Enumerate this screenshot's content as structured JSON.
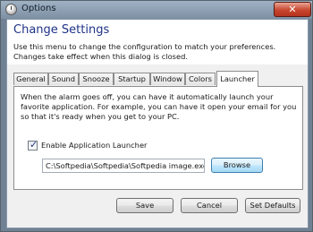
{
  "window": {
    "title": "Options",
    "close_label": "✕"
  },
  "header": {
    "heading": "Change Settings",
    "description": "Use this menu to change the configuration to match your preferences. Changes take effect when this dialog is closed."
  },
  "tabs": [
    {
      "label": "General",
      "active": false
    },
    {
      "label": "Sound",
      "active": false
    },
    {
      "label": "Snooze",
      "active": false
    },
    {
      "label": "Startup",
      "active": false
    },
    {
      "label": "Window",
      "active": false
    },
    {
      "label": "Colors",
      "active": false
    },
    {
      "label": "Launcher",
      "active": true
    }
  ],
  "launcher": {
    "info": "When the alarm goes off, you can have it automatically launch your favorite application.  For example, you can have it open your email for you so that it's ready when you get to your PC.",
    "enable_label": "Enable Application Launcher",
    "enable_checked": true,
    "path_value": "C:\\Softpedia\\Softpedia\\Softpedia image.exe",
    "browse_label": "Browse"
  },
  "footer": {
    "save_label": "Save",
    "cancel_label": "Cancel",
    "defaults_label": "Set Defaults"
  }
}
